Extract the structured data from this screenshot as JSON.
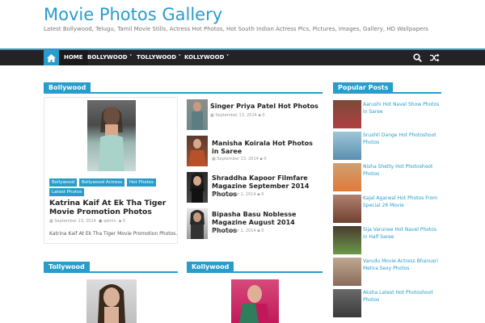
{
  "site": {
    "title": "Movie Photos Gallery",
    "tagline": "Latest Bollywood, Telugu, Tamil Movie Stills, Actress Hot Photos, Hot South Indian Actress Pics, Pictures, Images, Gallery, HD Wallpapers"
  },
  "nav": {
    "items": [
      "HOME",
      "BOLLYWOOD ˅",
      "TOLLYWOOD ˅",
      "KOLLYWOOD ˅"
    ],
    "icons": {
      "home": "home-icon",
      "search": "search-icon",
      "random": "shuffle-icon"
    }
  },
  "bollywood": {
    "label": "Bollywood",
    "featured": {
      "tags": [
        "Bollywood",
        "Bollywood Actress",
        "Hot Photos",
        "Latest Photos"
      ],
      "title": "Katrina Kaif At Ek Tha Tiger Movie Promotion Photos",
      "date": "September 13, 2014",
      "author": "admin",
      "comments": "0",
      "excerpt": "Katrina Kaif At Ek Tha Tiger Movie Promotion Photos."
    },
    "side_posts": [
      {
        "title": "Singer Priya Patel Hot Photos",
        "date": "September 13, 2014",
        "comments": "0"
      },
      {
        "title": "Manisha Koirala Hot Photos in Saree",
        "date": "September 13, 2014",
        "comments": "0"
      },
      {
        "title": "Shraddha Kapoor Filmfare Magazine September 2014 Photos",
        "date": "September 1, 2014",
        "comments": "0"
      },
      {
        "title": "Bipasha Basu Noblesse Magazine August 2014 Photos",
        "date": "September 1, 2014",
        "comments": "0"
      }
    ]
  },
  "tollywood": {
    "label": "Tollywood"
  },
  "kollywood": {
    "label": "Kollywood"
  },
  "popular": {
    "label": "Popular Posts",
    "items": [
      "Aarushi Hot Navel Show Photos in Saree",
      "Srushti Dange Hot Photoshoot Photos",
      "Nisha Shetty Hot Photoshoot Photos",
      "Kajal Agarwal Hot Photos From Special 26 Movie",
      "Sija Varunee Hot Navel Photos in Half Saree",
      "Varudu Movie Actress Bhanusri Mehra Sexy Photos",
      "Aksha Latest Hot Photoshoot Photos"
    ]
  },
  "colors": {
    "accent": "#289dcc",
    "nav_bg": "#232323"
  }
}
